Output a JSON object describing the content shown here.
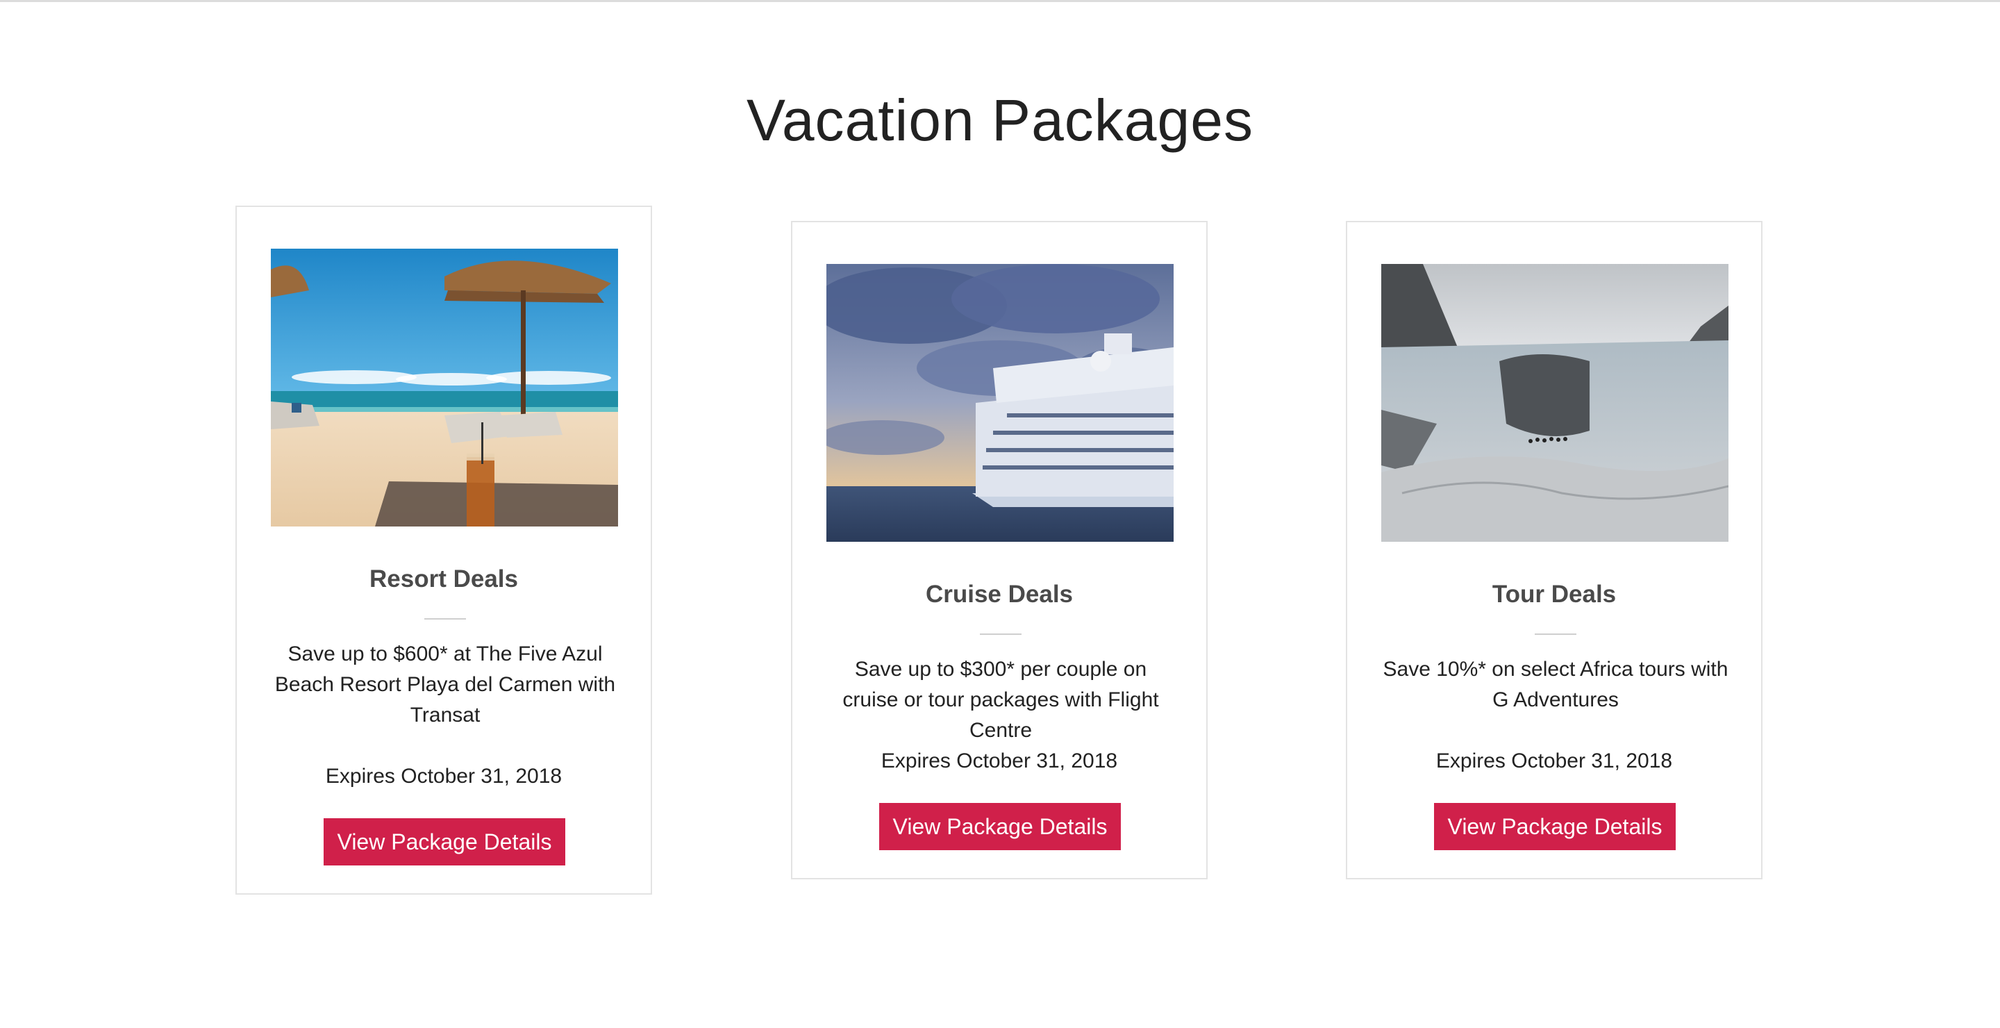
{
  "section": {
    "title": "Vacation Packages"
  },
  "packages": [
    {
      "title": "Resort Deals",
      "description": "Save up to $600* at The Five Azul Beach Resort Playa del Carmen with Transat",
      "expires": "Expires October 31, 2018",
      "button_label": "View Package Details",
      "image": "beach-resort-photo"
    },
    {
      "title": "Cruise Deals",
      "description": "Save up to $300* per couple on cruise or tour packages with Flight Centre",
      "expires": "Expires October 31, 2018",
      "button_label": "View Package Details",
      "image": "cruise-ship-photo"
    },
    {
      "title": "Tour Deals",
      "description": "Save 10%* on select Africa tours with G Adventures",
      "expires": "Expires October 31, 2018",
      "button_label": "View Package Details",
      "image": "glacier-tour-photo"
    }
  ],
  "colors": {
    "button": "#d0204a",
    "card_border": "#e3e3e3",
    "title_text": "#222222",
    "card_title_text": "#4a4a4a"
  }
}
